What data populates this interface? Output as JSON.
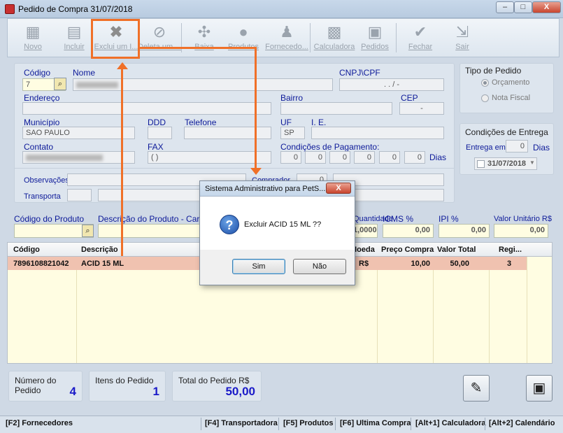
{
  "window": {
    "title": "Pedido de Compra 31/07/2018",
    "min": "–",
    "max": "□",
    "close": "X"
  },
  "toolbar": [
    {
      "label": "Novo",
      "icon": "new-icon",
      "glyph": "▦"
    },
    {
      "label": "Incluir",
      "icon": "include-icon",
      "glyph": "▤"
    },
    {
      "label": "Exclui um I...",
      "icon": "delete-x-icon",
      "glyph": "✖"
    },
    {
      "label": "Deleta um ...",
      "icon": "block-icon",
      "glyph": "⊘"
    },
    {
      "label": "Baixa",
      "icon": "network-icon",
      "glyph": "✣"
    },
    {
      "label": "Produtos",
      "icon": "bomb-icon",
      "glyph": "●"
    },
    {
      "label": "Fornecedo...",
      "icon": "users-icon",
      "glyph": "♟"
    },
    {
      "label": "Calculadora",
      "icon": "calculator-icon",
      "glyph": "▩"
    },
    {
      "label": "Pedidos",
      "icon": "orders-icon",
      "glyph": "▣"
    },
    {
      "label": "Fechar",
      "icon": "check-icon",
      "glyph": "✔"
    },
    {
      "label": "Sair",
      "icon": "exit-icon",
      "glyph": "⇲"
    }
  ],
  "form": {
    "codigo_label": "Código",
    "codigo": "7",
    "nome_label": "Nome",
    "cnpj_label": "CNPJ\\CPF",
    "cnpj": ". . / -",
    "endereco_label": "Endereço",
    "bairro_label": "Bairro",
    "cep_label": "CEP",
    "cep": "-",
    "municipio_label": "Município",
    "municipio": "SAO PAULO",
    "ddd_label": "DDD",
    "telefone_label": "Telefone",
    "uf_label": "UF",
    "uf": "SP",
    "ie_label": "I. E.",
    "contato_label": "Contato",
    "fax_label": "FAX",
    "fax": "(  )",
    "cond_pag_label": "Condições de Pagamento:",
    "cond_pag": [
      "0",
      "0",
      "0",
      "0",
      "0",
      "0"
    ],
    "dias": "Dias",
    "obs_label": "Observações",
    "comprador_label": "Comprador",
    "comprador": "0",
    "transporta_label": "Transporta"
  },
  "tipo": {
    "title": "Tipo de Pedido",
    "orcamento": "Orçamento",
    "nota_fiscal": "Nota Fiscal"
  },
  "entrega": {
    "title": "Condições de Entrega",
    "entrega_em": "Entrega em",
    "dias_val": "0",
    "dias": "Dias",
    "date": "31/07/2018"
  },
  "produto": {
    "codigo_label": "Código do Produto",
    "descricao_label": "Descrição do Produto -  Caract...",
    "qtd_label": "Quantidade",
    "qtd": "1,0000",
    "icms_label": "ICMS %",
    "icms": "0,00",
    "ipi_label": "IPI %",
    "ipi": "0,00",
    "vu_label": "Valor Unitário R$",
    "vu": "0,00"
  },
  "grid": {
    "headers": [
      "Código",
      "Descrição",
      "Moeda",
      "Preço Compra",
      "Valor Total",
      "Regi..."
    ],
    "rows": [
      {
        "codigo": "7896108821042",
        "descricao": "ACID 15 ML",
        "moeda": "R$",
        "preco": "10,00",
        "total": "50,00",
        "reg": "3"
      }
    ]
  },
  "summary": {
    "numero_label": "Número do Pedido",
    "numero": "4",
    "itens_label": "Itens do Pedido",
    "itens": "1",
    "total_label": "Total do Pedido R$",
    "total": "50,00"
  },
  "status": [
    "[F2] Fornecedores",
    "[F4] Transportadora",
    "[F5] Produtos",
    "[F6] Ultima Compra",
    "[Alt+1] Calculadora",
    "[Alt+2] Calendário"
  ],
  "dialog": {
    "title": "Sistema Administrativo para PetS...",
    "message": "Excluir ACID 15 ML ??",
    "yes": "Sim",
    "no": "Não",
    "close": "X",
    "icon": "question-icon"
  },
  "colors": {
    "highlight": "#f07028",
    "row": "#f0c2b0",
    "value": "#1a1ac8"
  }
}
